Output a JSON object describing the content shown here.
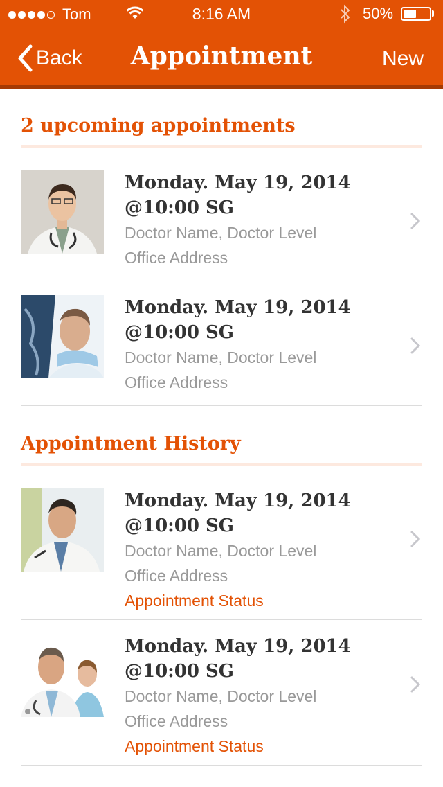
{
  "status_bar": {
    "carrier": "Tom",
    "time": "8:16 AM",
    "battery": "50%",
    "battery_level": 0.5
  },
  "nav": {
    "back_label": "Back",
    "title": "Appointment",
    "new_label": "New"
  },
  "upcoming": {
    "title": "2 upcoming appointments",
    "items": [
      {
        "date": "Monday. May 19, 2014",
        "time": "@10:00 SG",
        "doctor": "Doctor Name, Doctor Level",
        "address": "Office Address"
      },
      {
        "date": "Monday. May 19, 2014",
        "time": "@10:00 SG",
        "doctor": "Doctor Name, Doctor Level",
        "address": "Office Address"
      }
    ]
  },
  "history": {
    "title": "Appointment History",
    "items": [
      {
        "date": "Monday. May 19, 2014",
        "time": "@10:00 SG",
        "doctor": "Doctor Name, Doctor Level",
        "address": "Office Address",
        "status": "Appointment Status"
      },
      {
        "date": "Monday. May 19, 2014",
        "time": "@10:00 SG",
        "doctor": "Doctor Name, Doctor Level",
        "address": "Office Address",
        "status": "Appointment Status"
      }
    ]
  },
  "colors": {
    "accent": "#e35205",
    "nav_shadow": "#a63a03",
    "divider": "#fde9df"
  }
}
